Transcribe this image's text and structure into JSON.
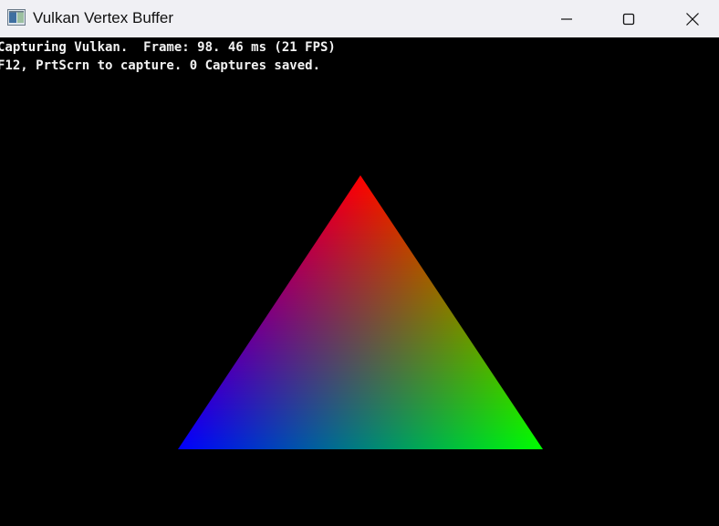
{
  "window": {
    "title": "Vulkan Vertex Buffer",
    "icon": "app-window-icon",
    "controls": {
      "minimize_icon": "minimize-icon",
      "maximize_icon": "maximize-icon",
      "close_icon": "close-icon"
    }
  },
  "overlay": {
    "line1": "Capturing Vulkan.  Frame: 98. 46 ms (21 FPS)",
    "line2": "F12, PrtScrn to capture. 0 Captures saved."
  },
  "triangle": {
    "colors": {
      "top": "#ff0000",
      "bottom_left": "#0000ff",
      "bottom_right": "#00ff00"
    }
  }
}
